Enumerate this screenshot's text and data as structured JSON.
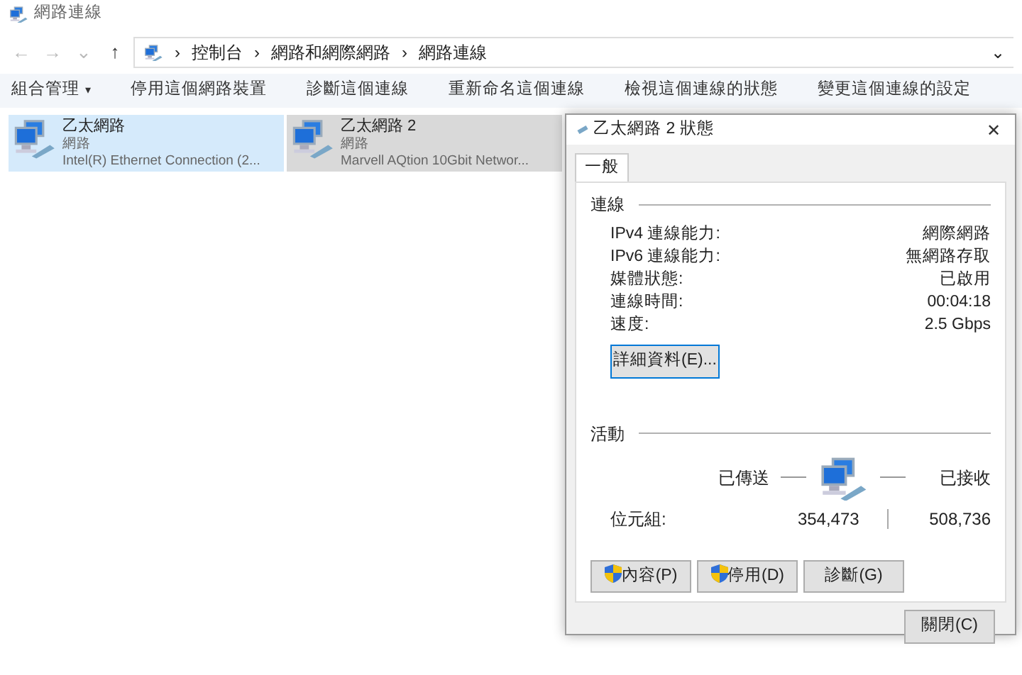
{
  "window": {
    "title": "網路連線"
  },
  "nav": {
    "back": "←",
    "forward": "→",
    "history": "⌄",
    "up": "↑"
  },
  "address": {
    "crumbs": [
      "控制台",
      "網路和網際網路",
      "網路連線"
    ],
    "separator": "›",
    "dropdown": "⌄"
  },
  "toolbar": [
    {
      "label": "組合管理",
      "caret": "▾"
    },
    {
      "label": "停用這個網路裝置"
    },
    {
      "label": "診斷這個連線"
    },
    {
      "label": "重新命名這個連線"
    },
    {
      "label": "檢視這個連線的狀態"
    },
    {
      "label": "變更這個連線的設定"
    }
  ],
  "connections": [
    {
      "name": "乙太網路",
      "status": "網路",
      "device": "Intel(R) Ethernet Connection (2...",
      "hovered": true,
      "selected": false
    },
    {
      "name": "乙太網路 2",
      "status": "網路",
      "device": "Marvell AQtion 10Gbit Networ...",
      "hovered": false,
      "selected": true
    }
  ],
  "dialog": {
    "title": "乙太網路 2 狀態",
    "close": "✕",
    "tabs": [
      {
        "label": "一般",
        "selected": true
      }
    ],
    "connection": {
      "label": "連線",
      "rows": [
        {
          "label": "IPv4 連線能力:",
          "value": "網際網路"
        },
        {
          "label": "IPv6 連線能力:",
          "value": "無網路存取"
        },
        {
          "label": "媒體狀態:",
          "value": "已啟用"
        },
        {
          "label": "連線時間:",
          "value": "00:04:18"
        },
        {
          "label": "速度:",
          "value": "2.5 Gbps"
        }
      ],
      "details_button": "詳細資料(E)..."
    },
    "activity": {
      "label": "活動",
      "sent_label": "已傳送",
      "received_label": "已接收",
      "bytes_label": "位元組:",
      "sent": "354,473",
      "received": "508,736"
    },
    "buttons": [
      {
        "label": "內容(P)",
        "shield": true
      },
      {
        "label": "停用(D)",
        "shield": true
      },
      {
        "label": "診斷(G)",
        "shield": false
      }
    ],
    "close_button": "關閉(C)"
  }
}
